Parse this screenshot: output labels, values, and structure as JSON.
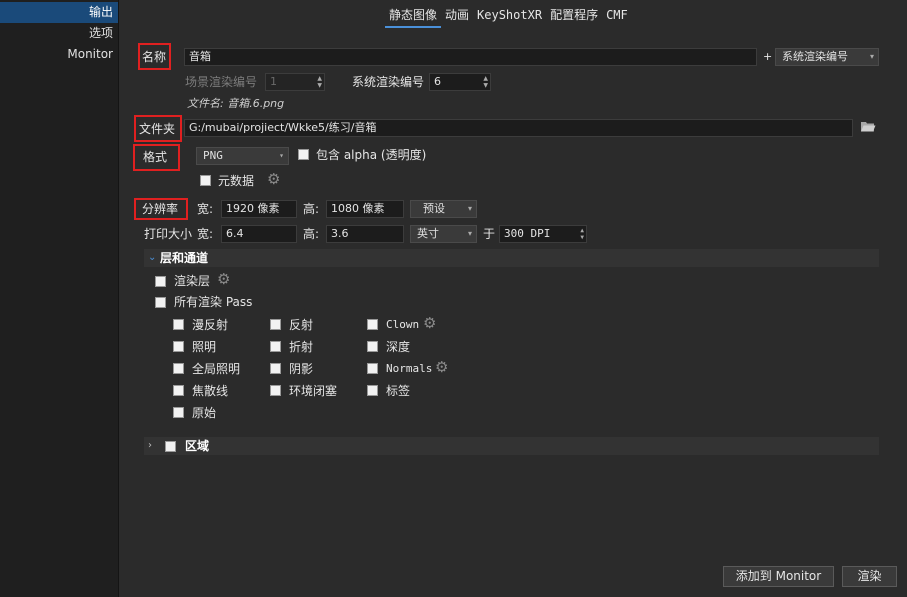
{
  "sidebar": {
    "items": [
      {
        "label": "输出"
      },
      {
        "label": "选项"
      },
      {
        "label": "Monitor"
      }
    ]
  },
  "tabs": [
    {
      "label": "静态图像"
    },
    {
      "label": "动画"
    },
    {
      "label": "KeyShotXR"
    },
    {
      "label": "配置程序"
    },
    {
      "label": "CMF"
    }
  ],
  "name": {
    "label": "名称",
    "value": "音箱",
    "plus": "+",
    "suffix_option": "系统渲染编号"
  },
  "scene_number": {
    "label": "场景渲染编号",
    "value": "1"
  },
  "system_number": {
    "label": "系统渲染编号",
    "value": "6"
  },
  "filename": {
    "text": "文件名: 音箱.6.png"
  },
  "folder": {
    "label": "文件夹",
    "value": "G:/mubai/projiect/Wkke5/练习/音箱"
  },
  "format": {
    "label": "格式",
    "value": "PNG",
    "alpha_label": "包含 alpha (透明度)",
    "metadata_label": "元数据"
  },
  "resolution": {
    "label": "分辨率",
    "width_label": "宽:",
    "width_value": "1920 像素",
    "height_label": "高:",
    "height_value": "1080 像素",
    "preset_label": "预设"
  },
  "print_size": {
    "label": "打印大小",
    "width_label": "宽:",
    "width_value": "6.4",
    "height_label": "高:",
    "height_value": "3.6",
    "unit": "英寸",
    "at_label": "于",
    "dpi_value": "300 DPI"
  },
  "layers": {
    "title": "层和通道",
    "render_layers": "渲染层",
    "all_passes": "所有渲染 Pass",
    "passes": [
      {
        "label": "漫反射"
      },
      {
        "label": "反射"
      },
      {
        "label": "Clown"
      },
      {
        "label": "照明"
      },
      {
        "label": "折射"
      },
      {
        "label": "深度"
      },
      {
        "label": "全局照明"
      },
      {
        "label": "阴影"
      },
      {
        "label": "Normals"
      },
      {
        "label": "焦散线"
      },
      {
        "label": "环境闭塞"
      },
      {
        "label": "标签"
      },
      {
        "label": "原始"
      }
    ]
  },
  "region": {
    "label": "区域"
  },
  "buttons": {
    "add_monitor": "添加到 Monitor",
    "render": "渲染"
  },
  "colors": {
    "accent": "#1a4a7a",
    "highlight_box": "#e02020",
    "tab_underline": "#4a90d9"
  }
}
